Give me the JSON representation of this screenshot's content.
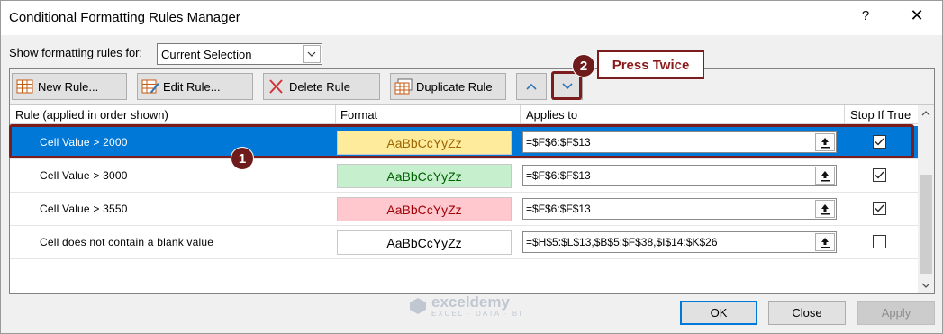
{
  "dialog": {
    "title": "Conditional Formatting Rules Manager",
    "help": "?",
    "close": "✕"
  },
  "filter": {
    "label": "Show formatting rules for:",
    "value": "Current Selection"
  },
  "toolbar": {
    "new_rule": "New Rule...",
    "edit_rule": "Edit Rule...",
    "delete_rule": "Delete Rule",
    "duplicate_rule": "Duplicate Rule"
  },
  "columns": {
    "rule": "Rule (applied in order shown)",
    "format": "Format",
    "applies": "Applies to",
    "stop": "Stop If True"
  },
  "rules": [
    {
      "name": "Cell Value > 2000",
      "preview": "AaBbCcYyZz",
      "preview_bg": "#ffeb9c",
      "preview_fg": "#9c6500",
      "applies": "=$F$6:$F$13",
      "stop": true,
      "selected": true
    },
    {
      "name": "Cell Value > 3000",
      "preview": "AaBbCcYyZz",
      "preview_bg": "#c6efce",
      "preview_fg": "#006100",
      "applies": "=$F$6:$F$13",
      "stop": true,
      "selected": false
    },
    {
      "name": "Cell Value > 3550",
      "preview": "AaBbCcYyZz",
      "preview_bg": "#ffc7ce",
      "preview_fg": "#9c0006",
      "applies": "=$F$6:$F$13",
      "stop": true,
      "selected": false
    },
    {
      "name": "Cell does not contain a blank value",
      "preview": "AaBbCcYyZz",
      "preview_bg": "#ffffff",
      "preview_fg": "#000000",
      "applies": "=$H$5:$L$13,$B$5:$F$38,$I$14:$K$26",
      "stop": false,
      "selected": false
    }
  ],
  "footer": {
    "ok": "OK",
    "close": "Close",
    "apply": "Apply"
  },
  "annotations": {
    "badge1": "1",
    "badge2": "2",
    "callout": "Press Twice"
  },
  "watermark": {
    "name": "exceldemy",
    "tagline": "EXCEL · DATA · BI"
  },
  "colors": {
    "selection": "#0078d7",
    "annotation": "#7b1d1d"
  }
}
